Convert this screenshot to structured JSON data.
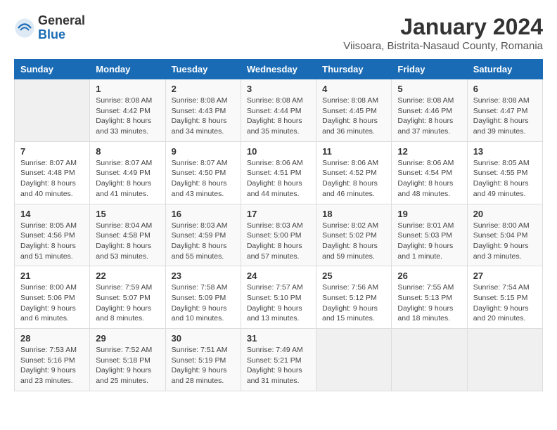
{
  "header": {
    "logo": {
      "general": "General",
      "blue": "Blue"
    },
    "title": "January 2024",
    "location": "Viisoara, Bistrita-Nasaud County, Romania"
  },
  "weekdays": [
    "Sunday",
    "Monday",
    "Tuesday",
    "Wednesday",
    "Thursday",
    "Friday",
    "Saturday"
  ],
  "weeks": [
    [
      {
        "day": "",
        "sunrise": "",
        "sunset": "",
        "daylight": ""
      },
      {
        "day": "1",
        "sunrise": "Sunrise: 8:08 AM",
        "sunset": "Sunset: 4:42 PM",
        "daylight": "Daylight: 8 hours and 33 minutes."
      },
      {
        "day": "2",
        "sunrise": "Sunrise: 8:08 AM",
        "sunset": "Sunset: 4:43 PM",
        "daylight": "Daylight: 8 hours and 34 minutes."
      },
      {
        "day": "3",
        "sunrise": "Sunrise: 8:08 AM",
        "sunset": "Sunset: 4:44 PM",
        "daylight": "Daylight: 8 hours and 35 minutes."
      },
      {
        "day": "4",
        "sunrise": "Sunrise: 8:08 AM",
        "sunset": "Sunset: 4:45 PM",
        "daylight": "Daylight: 8 hours and 36 minutes."
      },
      {
        "day": "5",
        "sunrise": "Sunrise: 8:08 AM",
        "sunset": "Sunset: 4:46 PM",
        "daylight": "Daylight: 8 hours and 37 minutes."
      },
      {
        "day": "6",
        "sunrise": "Sunrise: 8:08 AM",
        "sunset": "Sunset: 4:47 PM",
        "daylight": "Daylight: 8 hours and 39 minutes."
      }
    ],
    [
      {
        "day": "7",
        "sunrise": "Sunrise: 8:07 AM",
        "sunset": "Sunset: 4:48 PM",
        "daylight": "Daylight: 8 hours and 40 minutes."
      },
      {
        "day": "8",
        "sunrise": "Sunrise: 8:07 AM",
        "sunset": "Sunset: 4:49 PM",
        "daylight": "Daylight: 8 hours and 41 minutes."
      },
      {
        "day": "9",
        "sunrise": "Sunrise: 8:07 AM",
        "sunset": "Sunset: 4:50 PM",
        "daylight": "Daylight: 8 hours and 43 minutes."
      },
      {
        "day": "10",
        "sunrise": "Sunrise: 8:06 AM",
        "sunset": "Sunset: 4:51 PM",
        "daylight": "Daylight: 8 hours and 44 minutes."
      },
      {
        "day": "11",
        "sunrise": "Sunrise: 8:06 AM",
        "sunset": "Sunset: 4:52 PM",
        "daylight": "Daylight: 8 hours and 46 minutes."
      },
      {
        "day": "12",
        "sunrise": "Sunrise: 8:06 AM",
        "sunset": "Sunset: 4:54 PM",
        "daylight": "Daylight: 8 hours and 48 minutes."
      },
      {
        "day": "13",
        "sunrise": "Sunrise: 8:05 AM",
        "sunset": "Sunset: 4:55 PM",
        "daylight": "Daylight: 8 hours and 49 minutes."
      }
    ],
    [
      {
        "day": "14",
        "sunrise": "Sunrise: 8:05 AM",
        "sunset": "Sunset: 4:56 PM",
        "daylight": "Daylight: 8 hours and 51 minutes."
      },
      {
        "day": "15",
        "sunrise": "Sunrise: 8:04 AM",
        "sunset": "Sunset: 4:58 PM",
        "daylight": "Daylight: 8 hours and 53 minutes."
      },
      {
        "day": "16",
        "sunrise": "Sunrise: 8:03 AM",
        "sunset": "Sunset: 4:59 PM",
        "daylight": "Daylight: 8 hours and 55 minutes."
      },
      {
        "day": "17",
        "sunrise": "Sunrise: 8:03 AM",
        "sunset": "Sunset: 5:00 PM",
        "daylight": "Daylight: 8 hours and 57 minutes."
      },
      {
        "day": "18",
        "sunrise": "Sunrise: 8:02 AM",
        "sunset": "Sunset: 5:02 PM",
        "daylight": "Daylight: 8 hours and 59 minutes."
      },
      {
        "day": "19",
        "sunrise": "Sunrise: 8:01 AM",
        "sunset": "Sunset: 5:03 PM",
        "daylight": "Daylight: 9 hours and 1 minute."
      },
      {
        "day": "20",
        "sunrise": "Sunrise: 8:00 AM",
        "sunset": "Sunset: 5:04 PM",
        "daylight": "Daylight: 9 hours and 3 minutes."
      }
    ],
    [
      {
        "day": "21",
        "sunrise": "Sunrise: 8:00 AM",
        "sunset": "Sunset: 5:06 PM",
        "daylight": "Daylight: 9 hours and 6 minutes."
      },
      {
        "day": "22",
        "sunrise": "Sunrise: 7:59 AM",
        "sunset": "Sunset: 5:07 PM",
        "daylight": "Daylight: 9 hours and 8 minutes."
      },
      {
        "day": "23",
        "sunrise": "Sunrise: 7:58 AM",
        "sunset": "Sunset: 5:09 PM",
        "daylight": "Daylight: 9 hours and 10 minutes."
      },
      {
        "day": "24",
        "sunrise": "Sunrise: 7:57 AM",
        "sunset": "Sunset: 5:10 PM",
        "daylight": "Daylight: 9 hours and 13 minutes."
      },
      {
        "day": "25",
        "sunrise": "Sunrise: 7:56 AM",
        "sunset": "Sunset: 5:12 PM",
        "daylight": "Daylight: 9 hours and 15 minutes."
      },
      {
        "day": "26",
        "sunrise": "Sunrise: 7:55 AM",
        "sunset": "Sunset: 5:13 PM",
        "daylight": "Daylight: 9 hours and 18 minutes."
      },
      {
        "day": "27",
        "sunrise": "Sunrise: 7:54 AM",
        "sunset": "Sunset: 5:15 PM",
        "daylight": "Daylight: 9 hours and 20 minutes."
      }
    ],
    [
      {
        "day": "28",
        "sunrise": "Sunrise: 7:53 AM",
        "sunset": "Sunset: 5:16 PM",
        "daylight": "Daylight: 9 hours and 23 minutes."
      },
      {
        "day": "29",
        "sunrise": "Sunrise: 7:52 AM",
        "sunset": "Sunset: 5:18 PM",
        "daylight": "Daylight: 9 hours and 25 minutes."
      },
      {
        "day": "30",
        "sunrise": "Sunrise: 7:51 AM",
        "sunset": "Sunset: 5:19 PM",
        "daylight": "Daylight: 9 hours and 28 minutes."
      },
      {
        "day": "31",
        "sunrise": "Sunrise: 7:49 AM",
        "sunset": "Sunset: 5:21 PM",
        "daylight": "Daylight: 9 hours and 31 minutes."
      },
      {
        "day": "",
        "sunrise": "",
        "sunset": "",
        "daylight": ""
      },
      {
        "day": "",
        "sunrise": "",
        "sunset": "",
        "daylight": ""
      },
      {
        "day": "",
        "sunrise": "",
        "sunset": "",
        "daylight": ""
      }
    ]
  ]
}
